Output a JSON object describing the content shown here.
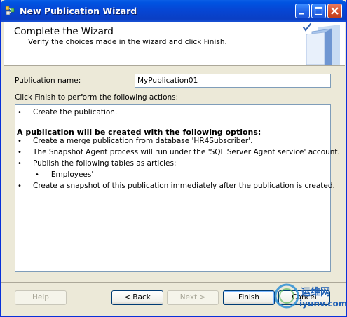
{
  "window": {
    "title": "New Publication Wizard"
  },
  "header": {
    "title": "Complete the Wizard",
    "subtitle": "Verify the choices made in the wizard and click Finish."
  },
  "publication": {
    "name_label": "Publication name:",
    "name_value": "MyPublication01"
  },
  "actions_label": "Click Finish to perform the following actions:",
  "actions": {
    "bullet": "•",
    "item1": "Create the publication.",
    "options_heading": "A publication will be created with the following options:",
    "item2": "Create a merge publication from database 'HR4Subscriber'.",
    "item3": "The Snapshot Agent process will run under the 'SQL Server Agent service' account.",
    "item4": "Publish the following tables as articles:",
    "subitem1": "'Employees'",
    "item5": "Create a snapshot of this publication immediately after the publication is created."
  },
  "buttons": {
    "help": "Help",
    "back": "< Back",
    "next": "Next >",
    "finish": "Finish",
    "cancel": "Cancel"
  },
  "watermark": {
    "line1": "运维网",
    "line2": "iyunv.com"
  },
  "colors": {
    "titlebar": "#0a3fc4",
    "dialog_bg": "#ece9d8",
    "input_border": "#7f9db9",
    "watermark": "#1f5fb4"
  },
  "icons": [
    "app-icon",
    "minimize-icon",
    "maximize-icon",
    "close-icon",
    "wizard-book-icon"
  ]
}
